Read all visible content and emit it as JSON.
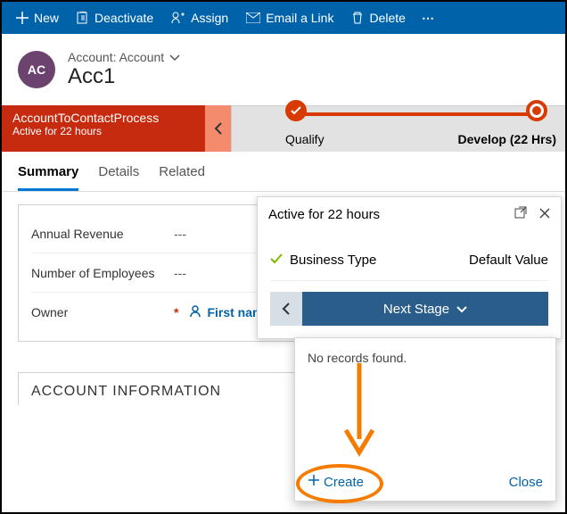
{
  "commandbar": {
    "new": "New",
    "deactivate": "Deactivate",
    "assign": "Assign",
    "email": "Email a Link",
    "delete": "Delete"
  },
  "header": {
    "avatar": "AC",
    "entity": "Account: Account",
    "name": "Acc1"
  },
  "bpf": {
    "name": "AccountToContactProcess",
    "duration": "Active for 22 hours",
    "stage1": "Qualify",
    "stage2": "Develop  (22 Hrs)"
  },
  "tabs": {
    "summary": "Summary",
    "details": "Details",
    "related": "Related"
  },
  "fields": {
    "revenue_label": "Annual Revenue",
    "revenue_value": "---",
    "employees_label": "Number of Employees",
    "employees_value": "---",
    "owner_label": "Owner",
    "owner_value": "First name La"
  },
  "section": {
    "title": "ACCOUNT INFORMATION"
  },
  "flyout": {
    "active": "Active for 22 hours",
    "field_label": "Business Type",
    "field_value": "Default Value",
    "next": "Next Stage"
  },
  "popover": {
    "msg": "No records found.",
    "create": "Create",
    "close": "Close"
  }
}
